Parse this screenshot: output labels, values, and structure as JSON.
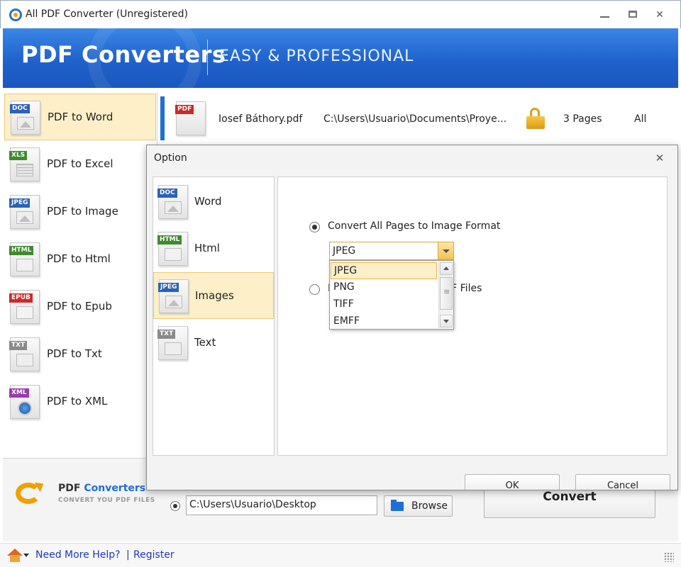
{
  "window": {
    "title": "All PDF Converter (Unregistered)"
  },
  "banner": {
    "brand": "PDF Converters",
    "tagline": "EASY & PROFESSIONAL"
  },
  "sidebar": {
    "items": [
      {
        "tag": "DOC",
        "label": "PDF to Word",
        "icon": "word-doc-icon",
        "active": true
      },
      {
        "tag": "XLS",
        "label": "PDF to Excel",
        "icon": "excel-doc-icon",
        "active": false
      },
      {
        "tag": "JPEG",
        "label": "PDF to Image",
        "icon": "image-doc-icon",
        "active": false
      },
      {
        "tag": "HTML",
        "label": "PDF to Html",
        "icon": "html-doc-icon",
        "active": false
      },
      {
        "tag": "EPUB",
        "label": "PDF to Epub",
        "icon": "epub-doc-icon",
        "active": false
      },
      {
        "tag": "TXT",
        "label": "PDF to Txt",
        "icon": "txt-doc-icon",
        "active": false
      },
      {
        "tag": "XML",
        "label": "PDF to XML",
        "icon": "xml-doc-icon",
        "active": false
      }
    ]
  },
  "file_list": {
    "rows": [
      {
        "tag": "PDF",
        "name": "Iosef Báthory.pdf",
        "path": "C:\\Users\\Usuario\\Documents\\Proye...",
        "pages": "3 Pages",
        "range": "All",
        "lock_icon": "unlocked-padlock-icon"
      }
    ]
  },
  "dialog": {
    "title": "Option",
    "close_glyph": "✕",
    "categories": [
      {
        "tag": "DOC",
        "label": "Word",
        "active": false
      },
      {
        "tag": "HTML",
        "label": "Html",
        "active": false
      },
      {
        "tag": "JPEG",
        "label": "Images",
        "active": true
      },
      {
        "tag": "TXT",
        "label": "Text",
        "active": false
      }
    ],
    "option_all_pages": "Convert All Pages to Image Format",
    "option_files_tail": "F Files",
    "option_files_lead": "I",
    "format_select": {
      "selected": "JPEG",
      "options": [
        "JPEG",
        "PNG",
        "TIFF",
        "EMFF"
      ]
    },
    "ok_label": "OK",
    "cancel_label": "Cancel"
  },
  "bottom": {
    "logo_brand_1": "PDF ",
    "logo_brand_2": "Converters",
    "logo_tagline": "CONVERT YOU PDF FILES",
    "output_path": "C:\\Users\\Usuario\\Desktop",
    "browse_label": "Browse",
    "convert_label": "Convert"
  },
  "status": {
    "help_link": "Need More Help?",
    "separator": "|",
    "register_link": "Register"
  },
  "colors": {
    "accent_blue": "#1e6fd6",
    "selection_fill": "#fdf0c8",
    "selection_border": "#f0c878",
    "link_blue": "#2238b8"
  }
}
